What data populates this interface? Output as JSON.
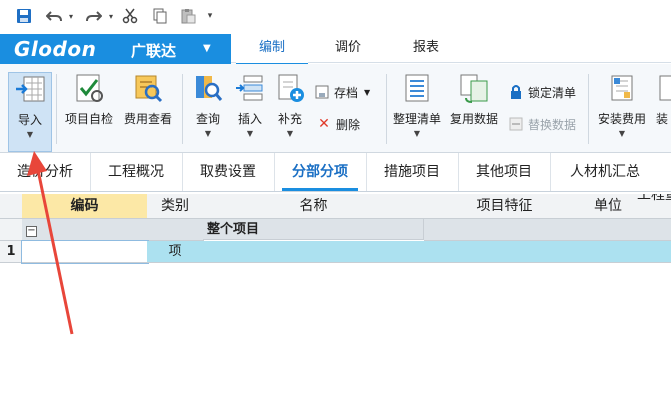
{
  "brand": {
    "name": "Glodon",
    "cn": "广联达"
  },
  "ribbon_tabs": [
    {
      "label": "编制",
      "active": true
    },
    {
      "label": "调价",
      "active": false
    },
    {
      "label": "报表",
      "active": false
    }
  ],
  "toolbar": {
    "import": "导入",
    "project_check": "项目自检",
    "fee_view": "费用查看",
    "query": "查询",
    "insert": "插入",
    "supplement": "补充",
    "save": "存档",
    "delete": "删除",
    "organize": "整理清单",
    "reuse": "复用数据",
    "lock": "锁定清单",
    "replace": "替换数据",
    "install_fee": "安装费用",
    "partial": "装"
  },
  "view_tabs": [
    {
      "label": "造价分析",
      "active": false
    },
    {
      "label": "工程概况",
      "active": false
    },
    {
      "label": "取费设置",
      "active": false
    },
    {
      "label": "分部分项",
      "active": true
    },
    {
      "label": "措施项目",
      "active": false
    },
    {
      "label": "其他项目",
      "active": false
    },
    {
      "label": "人材机汇总",
      "active": false
    }
  ],
  "table": {
    "headers": [
      "编码",
      "类别",
      "名称",
      "项目特征",
      "单位",
      "工程量"
    ],
    "rows": [
      {
        "num": "",
        "code": "",
        "type": "",
        "name": "整个项目"
      },
      {
        "num": "1",
        "code": "",
        "type": "项",
        "name": ""
      }
    ]
  },
  "colors": {
    "accent": "#1a8ee0",
    "selected_row": "#ace1f0",
    "header_selected": "#fce8a6",
    "arrow": "#e8463a"
  }
}
